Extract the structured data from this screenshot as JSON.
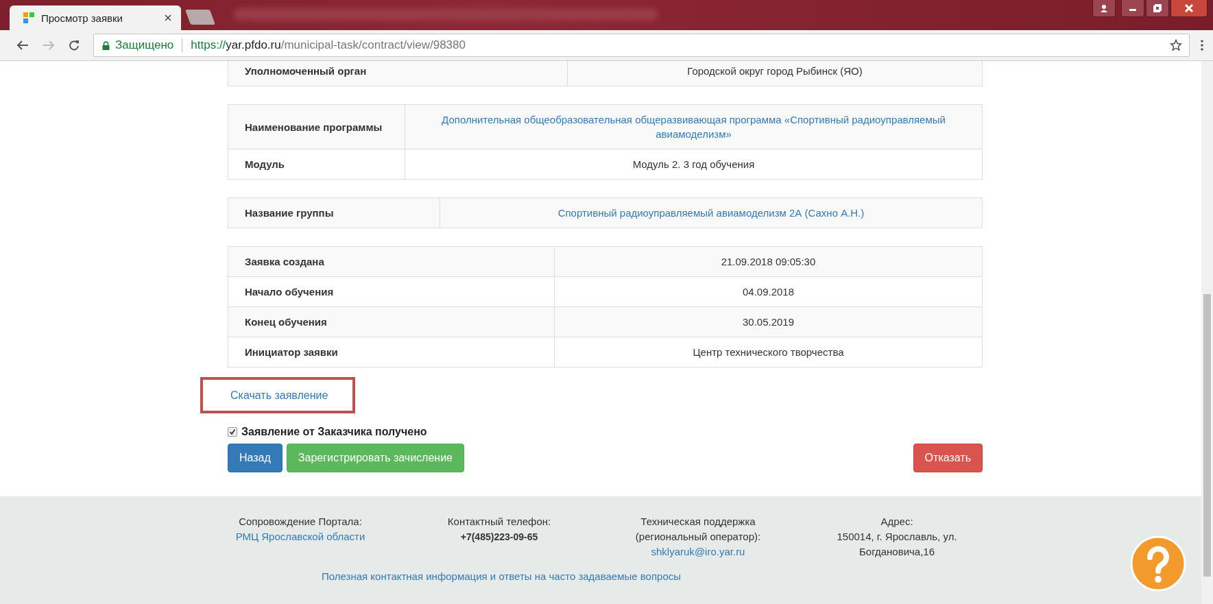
{
  "browser": {
    "tab": {
      "title": "Просмотр заявки",
      "selected": true
    },
    "address": {
      "secure_label": "Защищено",
      "scheme": "https://",
      "host": "yar.pfdo.ru",
      "path": "/municipal-task/contract/view/98380"
    }
  },
  "tables": [
    {
      "rows": [
        {
          "label": "Уполномоченный орган",
          "value": "Городской округ город Рыбинск (ЯО)",
          "kind": "text"
        }
      ]
    },
    {
      "rows": [
        {
          "label": "Наименование программы",
          "value": "Дополнительная общеобразовательная общеразвивающая программа «Спортивный радиоуправляемый авиамоделизм»",
          "kind": "link"
        },
        {
          "label": "Модуль",
          "value": "Модуль 2. 3 год обучения",
          "kind": "text"
        }
      ]
    },
    {
      "rows": [
        {
          "label": "Название группы",
          "value": "Спортивный радиоуправляемый авиамоделизм 2А (Сахно А.Н.)",
          "kind": "link"
        }
      ]
    },
    {
      "rows": [
        {
          "label": "Заявка создана",
          "value": "21.09.2018 09:05:30",
          "kind": "text"
        },
        {
          "label": "Начало обучения",
          "value": "04.09.2018",
          "kind": "text"
        },
        {
          "label": "Конец обучения",
          "value": "30.05.2019",
          "kind": "text"
        },
        {
          "label": "Инициатор заявки",
          "value": "Центр технического творчества",
          "kind": "text"
        }
      ]
    }
  ],
  "download_link": {
    "label": "Скачать заявление",
    "highlighted": true
  },
  "received": {
    "label": "Заявление от Заказчика получено",
    "checked": true
  },
  "buttons": [
    {
      "label": "Назад",
      "kind": "primary"
    },
    {
      "label": "Зарегистрировать зачисление",
      "kind": "success"
    },
    {
      "label": "Отказать",
      "kind": "danger"
    }
  ],
  "footer": {
    "columns": [
      {
        "lines": [
          {
            "text": "Сопровождение Портала:",
            "kind": "text"
          },
          {
            "text": "РМЦ Ярославской области",
            "kind": "link"
          }
        ]
      },
      {
        "lines": [
          {
            "text": "Контактный телефон:",
            "kind": "text"
          },
          {
            "text": "+7(485)223-09-65",
            "kind": "bold"
          }
        ]
      },
      {
        "lines": [
          {
            "text": "Техническая поддержка",
            "kind": "text"
          },
          {
            "text": "(региональный оператор):",
            "kind": "text"
          },
          {
            "text": "shklyaruk@iro.yar.ru",
            "kind": "link"
          }
        ]
      },
      {
        "lines": [
          {
            "text": "Адрес:",
            "kind": "text"
          },
          {
            "text": "150014, г. Ярославль, ул.",
            "kind": "text"
          },
          {
            "text": "Богдановича,16",
            "kind": "text"
          }
        ]
      }
    ],
    "bottom_link": "Полезная контактная информация и ответы на часто задаваемые вопросы"
  }
}
